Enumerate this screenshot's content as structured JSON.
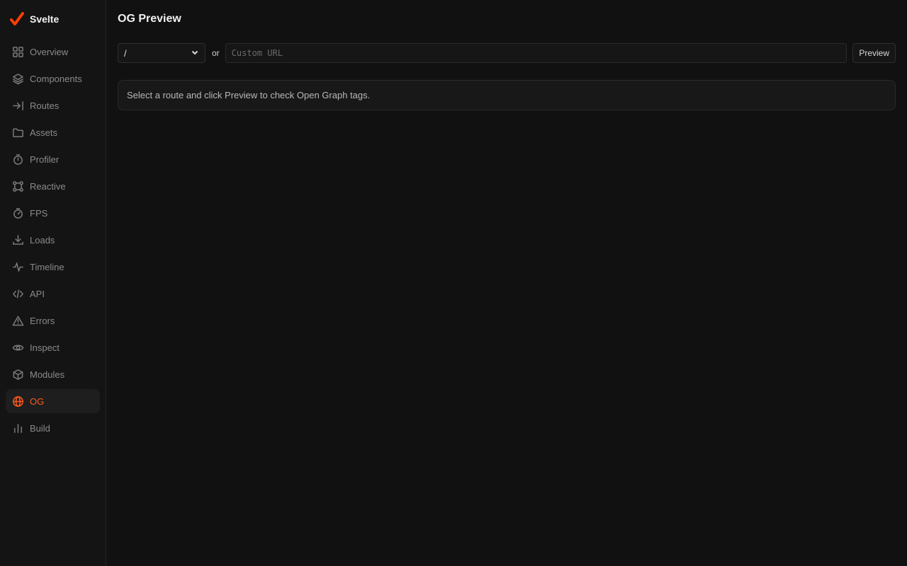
{
  "brand": {
    "name": "Svelte",
    "logo_icon": "svelte-logo-icon",
    "accent": "#ff3e00"
  },
  "sidebar": {
    "items": [
      {
        "label": "Overview",
        "icon": "grid-icon"
      },
      {
        "label": "Components",
        "icon": "layers-icon"
      },
      {
        "label": "Routes",
        "icon": "route-arrow-icon"
      },
      {
        "label": "Assets",
        "icon": "folder-icon"
      },
      {
        "label": "Profiler",
        "icon": "stopwatch-icon"
      },
      {
        "label": "Reactive",
        "icon": "graph-nodes-icon"
      },
      {
        "label": "FPS",
        "icon": "timer-icon"
      },
      {
        "label": "Loads",
        "icon": "download-icon"
      },
      {
        "label": "Timeline",
        "icon": "pulse-icon"
      },
      {
        "label": "API",
        "icon": "code-icon"
      },
      {
        "label": "Errors",
        "icon": "warning-icon"
      },
      {
        "label": "Inspect",
        "icon": "eye-icon"
      },
      {
        "label": "Modules",
        "icon": "cube-icon"
      },
      {
        "label": "OG",
        "icon": "globe-icon",
        "active": true
      },
      {
        "label": "Build",
        "icon": "bar-chart-icon"
      }
    ]
  },
  "main": {
    "title": "OG Preview",
    "route_select": {
      "value": "/"
    },
    "or_label": "or",
    "url_input": {
      "value": "",
      "placeholder": "Custom URL"
    },
    "preview_label": "Preview",
    "info_text": "Select a route and click Preview to check Open Graph tags."
  },
  "colors": {
    "active": "#ff5a1f",
    "background": "#111111",
    "sidebar": "#141414"
  }
}
